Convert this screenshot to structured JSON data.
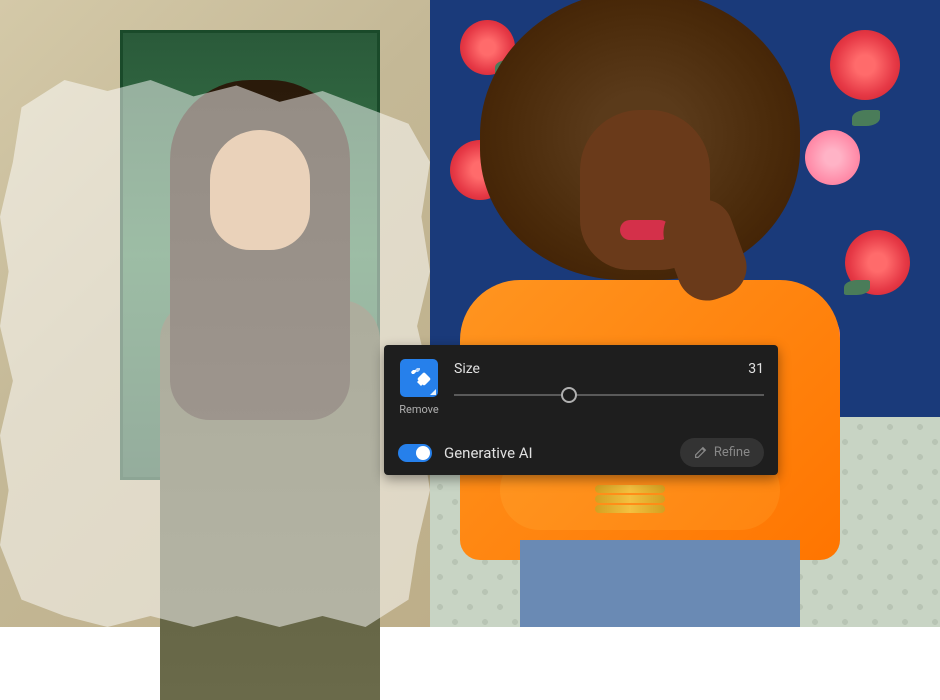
{
  "tool_panel": {
    "tool_icon": "eraser-sparkle-icon",
    "tool_label": "Remove",
    "slider": {
      "label": "Size",
      "value": "31"
    },
    "toggle": {
      "label": "Generative AI",
      "state": "on"
    },
    "refine_button": {
      "label": "Refine",
      "icon": "pencil-icon",
      "enabled": false
    }
  }
}
